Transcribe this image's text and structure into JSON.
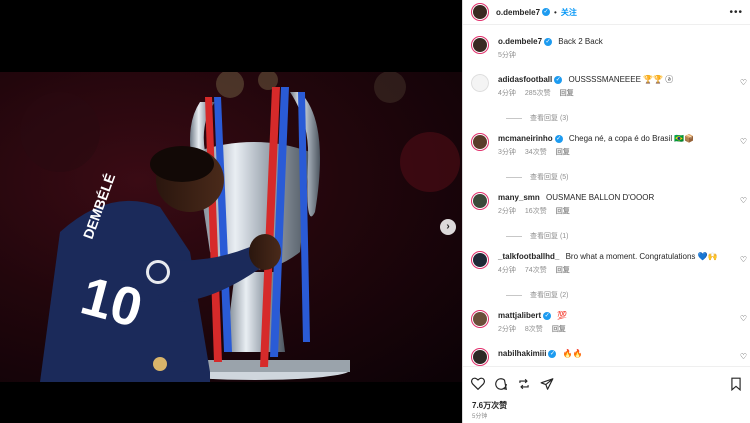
{
  "post": {
    "username": "o.dembele7",
    "follow_label": "关注",
    "more_label": "•••",
    "caption_user": "o.dembele7",
    "caption_text": "Back 2 Back",
    "caption_time": "5分钟",
    "likes": "7.6万次赞",
    "time_ago": "5分钟",
    "jersey_name": "DEMBÉLÉ",
    "jersey_number": "10",
    "next_arrow": "›"
  },
  "comments": [
    {
      "user": "adidasfootball",
      "text": "OUSSSSMANEEEE 🏆🏆 ⓐ",
      "time": "4分钟",
      "likes": "285次赞",
      "reply": "回复",
      "view_replies": "查看回复 (3)",
      "verified": true,
      "avatar_color": "#f4f4f4"
    },
    {
      "user": "mcmaneirinho",
      "text": "Chega né, a copa é do Brasil 🇧🇷📦",
      "time": "3分钟",
      "likes": "34次赞",
      "reply": "回复",
      "view_replies": "查看回复 (5)",
      "verified": true,
      "avatar_color": "#5a3d2b"
    },
    {
      "user": "many_smn",
      "text": "OUSMANE BALLON D'OOOR",
      "time": "2分钟",
      "likes": "16次赞",
      "reply": "回复",
      "view_replies": "查看回复 (1)",
      "verified": false,
      "avatar_color": "#3b4a3a"
    },
    {
      "user": "_talkfootballhd_",
      "text": "Bro what a moment. Congratulations 💙🙌",
      "time": "4分钟",
      "likes": "74次赞",
      "reply": "回复",
      "view_replies": "查看回复 (2)",
      "verified": false,
      "avatar_color": "#1f2937"
    },
    {
      "user": "mattjalibert",
      "text": "💯",
      "time": "2分钟",
      "likes": "8次赞",
      "reply": "回复",
      "view_replies": "",
      "verified": true,
      "avatar_color": "#6b4f3a"
    },
    {
      "user": "nabilhakimiii",
      "text": "🔥🔥",
      "time": "",
      "likes": "",
      "reply": "",
      "view_replies": "",
      "verified": true,
      "avatar_color": "#2d2a26"
    }
  ],
  "icons": {
    "heart": "♡",
    "check": "✓"
  },
  "colors": {
    "psg_navy": "#1b2a5a",
    "background_red": "#3a0b14",
    "verified_blue": "#1d9bf0",
    "follow_blue": "#0095f6"
  }
}
